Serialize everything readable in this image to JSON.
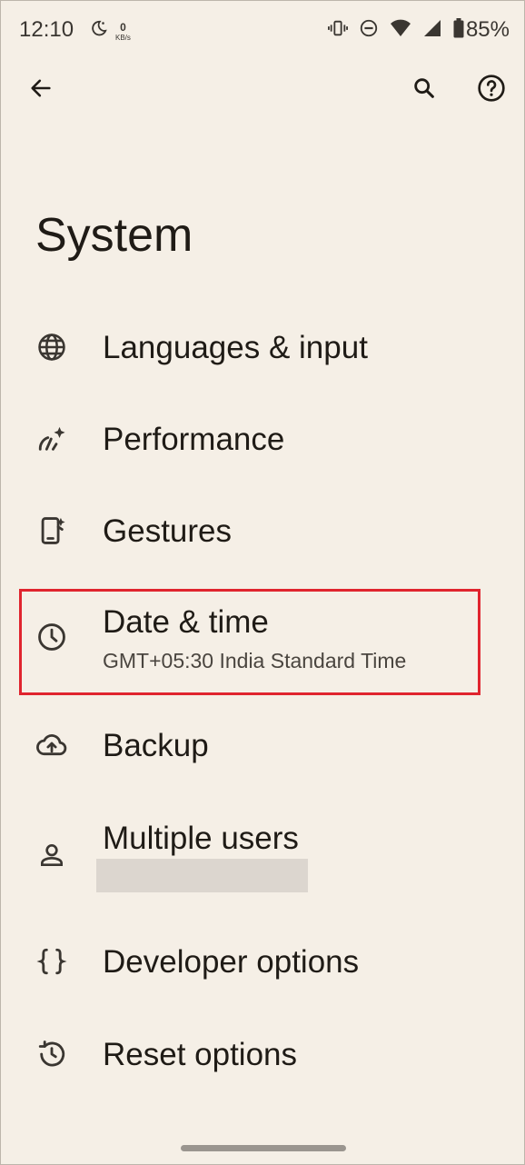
{
  "status_bar": {
    "time": "12:10",
    "net_speed_value": "0",
    "net_speed_unit": "KB/s",
    "battery": "85%",
    "icons": [
      "moon-alarm-icon",
      "vibrate-icon",
      "do-not-disturb-icon",
      "wifi-icon",
      "cellular-signal-icon",
      "battery-icon"
    ]
  },
  "app_bar": {
    "back_icon": "arrow-back-icon",
    "search_icon": "search-icon",
    "help_icon": "help-icon"
  },
  "page": {
    "title": "System"
  },
  "settings_items": [
    {
      "label": "Languages & input",
      "icon": "globe-icon"
    },
    {
      "label": "Performance",
      "icon": "performance-icon"
    },
    {
      "label": "Gestures",
      "icon": "gestures-icon"
    },
    {
      "label": "Date & time",
      "summary": "GMT+05:30 India Standard Time",
      "icon": "clock-icon",
      "highlighted": true
    },
    {
      "label": "Backup",
      "icon": "cloud-upload-icon"
    },
    {
      "label": "Multiple users",
      "summary_redacted": true,
      "icon": "person-icon"
    },
    {
      "label": "Developer options",
      "icon": "braces-icon"
    },
    {
      "label": "Reset options",
      "icon": "history-icon"
    }
  ],
  "colors": {
    "background": "#f5efe6",
    "text": "#1f1b16",
    "highlight": "#e0242e"
  }
}
